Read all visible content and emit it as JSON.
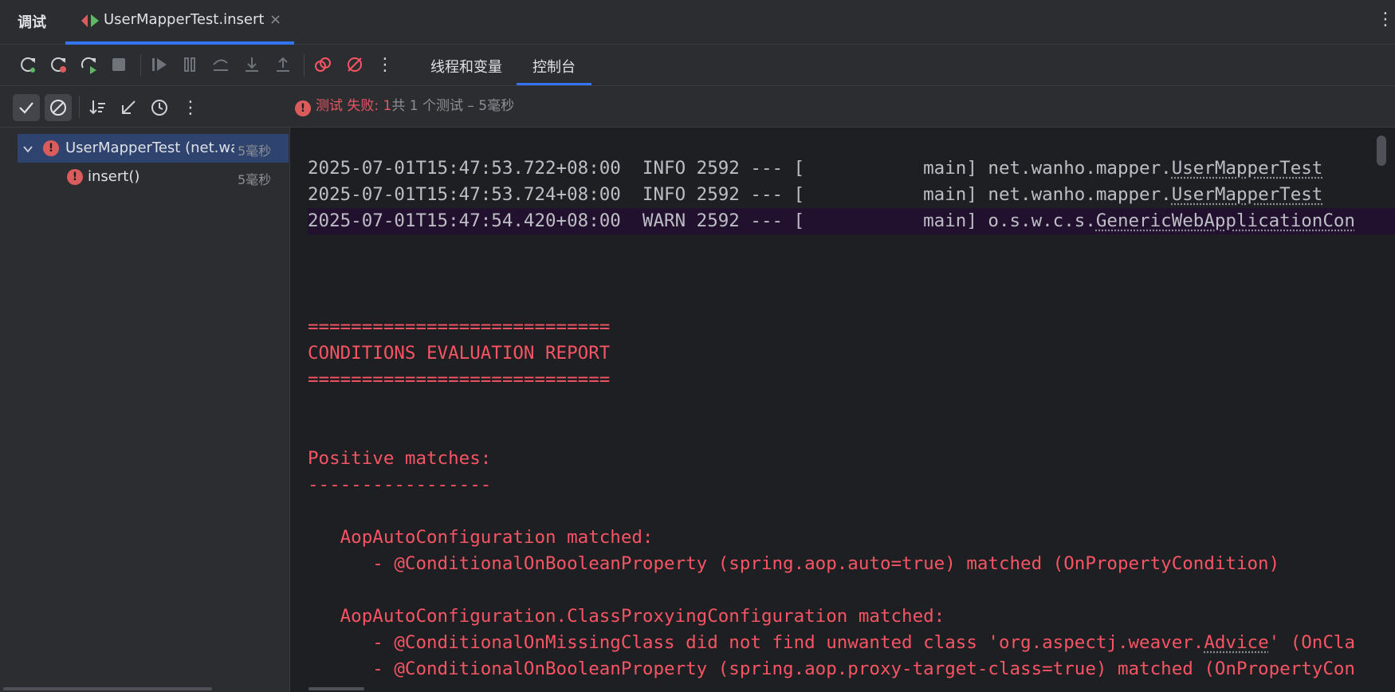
{
  "tabbar": {
    "title": "调试",
    "tab_label": "UserMapperTest.insert",
    "close_glyph": "×",
    "more_glyph": "⋮"
  },
  "toolbar": {
    "view_tabs": [
      "线程和变量",
      "控制台"
    ],
    "more_glyph": "⋮"
  },
  "subbar": {
    "more_glyph": "⋮"
  },
  "status": {
    "fail_text": "测试 失败: 1",
    "rest_text": "共 1 个测试 – 5毫秒"
  },
  "tree": {
    "items": [
      {
        "label": "UserMapperTest (net.wan",
        "time": "5毫秒"
      },
      {
        "label": "insert()",
        "time": "5毫秒"
      }
    ]
  },
  "console": {
    "log": [
      {
        "prefix": "2025-07-01T15:47:53.722+08:00  INFO 2592 --- [           main] net.wanho.mapper.",
        "link": "UserMapperTest"
      },
      {
        "prefix": "2025-07-01T15:47:53.724+08:00  INFO 2592 --- [           main] net.wanho.mapper.",
        "link": "UserMapperTest"
      },
      {
        "prefix": "2025-07-01T15:47:54.420+08:00  WARN 2592 --- [           main] o.s.w.c.s.",
        "link": "GenericWebApplicationCon"
      }
    ],
    "report": {
      "rule": "============================",
      "heading": "CONDITIONS EVALUATION REPORT",
      "positive": "Positive matches:",
      "dashes": "-----------------",
      "aop1": "   AopAutoConfiguration matched:",
      "aop1_detail": "      - @ConditionalOnBooleanProperty (spring.aop.auto=true) matched (OnPropertyCondition)",
      "aop2": "   AopAutoConfiguration.ClassProxyingConfiguration matched:",
      "aop2_detail1_pre": "      - @ConditionalOnMissingClass did not find unwanted class 'org.aspectj.weaver.",
      "aop2_detail1_link": "Advice",
      "aop2_detail1_post": "' (OnCla",
      "aop2_detail2": "      - @ConditionalOnBooleanProperty (spring.aop.proxy-target-class=true) matched (OnPropertyCon"
    }
  },
  "colors": {
    "accent": "#3574f0",
    "error": "#db5c5c",
    "console_red": "#f75464",
    "warn_bg": "#21102e"
  }
}
